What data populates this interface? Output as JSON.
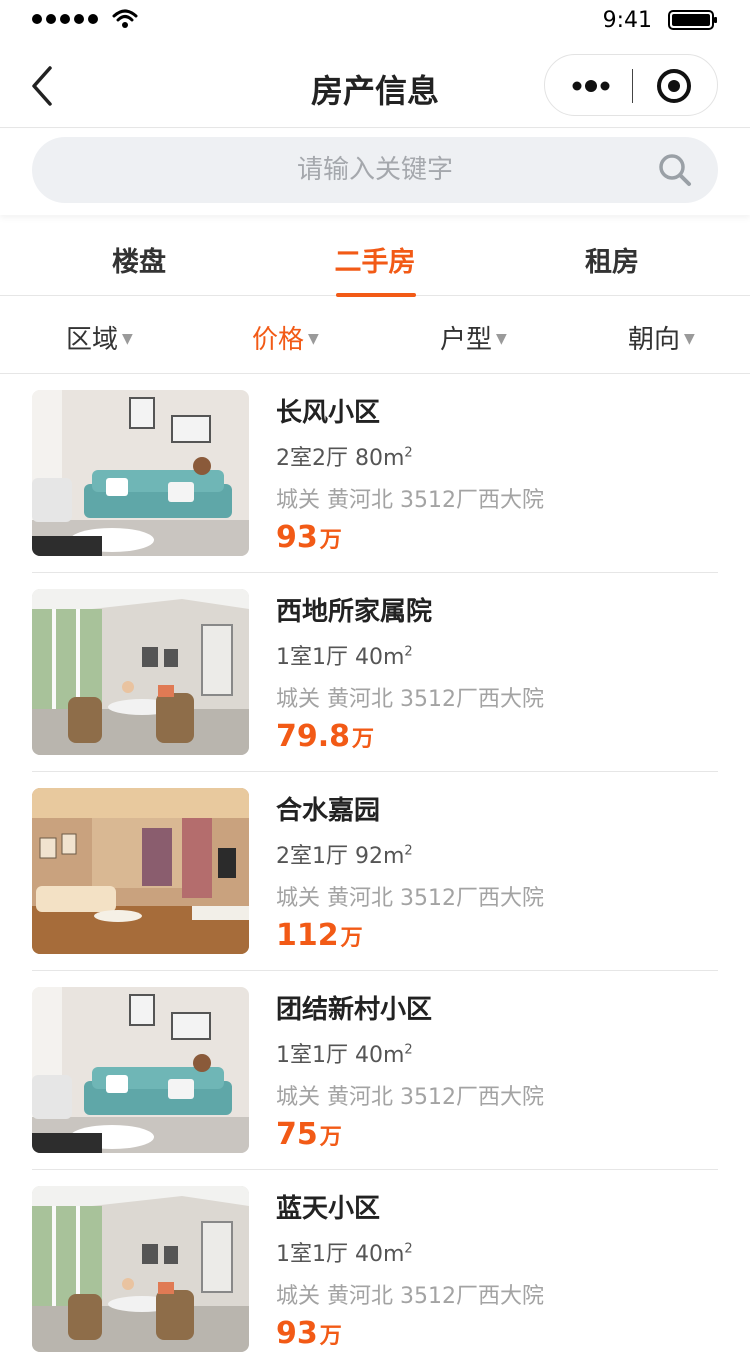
{
  "status_bar": {
    "time": "9:41"
  },
  "nav": {
    "title": "房产信息"
  },
  "search": {
    "placeholder": "请输入关键字"
  },
  "tabs": [
    {
      "label": "楼盘",
      "active": false
    },
    {
      "label": "二手房",
      "active": true
    },
    {
      "label": "租房",
      "active": false
    }
  ],
  "filters": [
    {
      "label": "区域",
      "active": false
    },
    {
      "label": "价格",
      "active": true
    },
    {
      "label": "户型",
      "active": false
    },
    {
      "label": "朝向",
      "active": false
    }
  ],
  "filter_caret": "▼",
  "listings": [
    {
      "title": "长风小区",
      "layout": "2室2厅 80m",
      "area_sup": "2",
      "address": "城关 黄河北 3512厂西大院",
      "price": "93",
      "unit": "万",
      "photo": "living-room-teal-sofa"
    },
    {
      "title": "西地所家属院",
      "layout": "1室1厅 40m",
      "area_sup": "2",
      "address": "城关 黄河北 3512厂西大院",
      "price": "79.8",
      "unit": "万",
      "photo": "sunroom-wicker-chairs"
    },
    {
      "title": "合水嘉园",
      "layout": "2室1厅 92m",
      "area_sup": "2",
      "address": "城关 黄河北 3512厂西大院",
      "price": "112",
      "unit": "万",
      "photo": "warm-living-room"
    },
    {
      "title": "团结新村小区",
      "layout": "1室1厅 40m",
      "area_sup": "2",
      "address": "城关 黄河北 3512厂西大院",
      "price": "75",
      "unit": "万",
      "photo": "living-room-teal-sofa"
    },
    {
      "title": "蓝天小区",
      "layout": "1室1厅 40m",
      "area_sup": "2",
      "address": "城关 黄河北 3512厂西大院",
      "price": "93",
      "unit": "万",
      "photo": "sunroom-wicker-chairs"
    }
  ],
  "colors": {
    "accent": "#f25a16",
    "text": "#333333",
    "muted": "#a3a3a3",
    "search_bg": "#eef0f3"
  }
}
